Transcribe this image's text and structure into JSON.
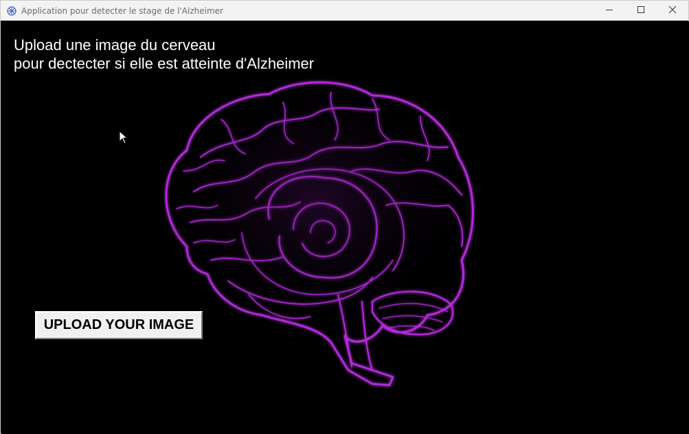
{
  "window": {
    "title": "Application pour detecter le stage de l'Alzheimer",
    "app_icon": "brain-icon",
    "controls": [
      "minimize-icon",
      "maximize-icon",
      "close-icon"
    ]
  },
  "main": {
    "headline_line1": "Upload une image du cerveau",
    "headline_line2": "pour dectecter si elle est atteinte d'Alzheimer",
    "upload_button_label": "UPLOAD YOUR IMAGE",
    "image": "brain-image"
  },
  "colors": {
    "background": "#000000",
    "brain_accent": "#b12cd8",
    "titlebar": "#f3f3f3"
  }
}
